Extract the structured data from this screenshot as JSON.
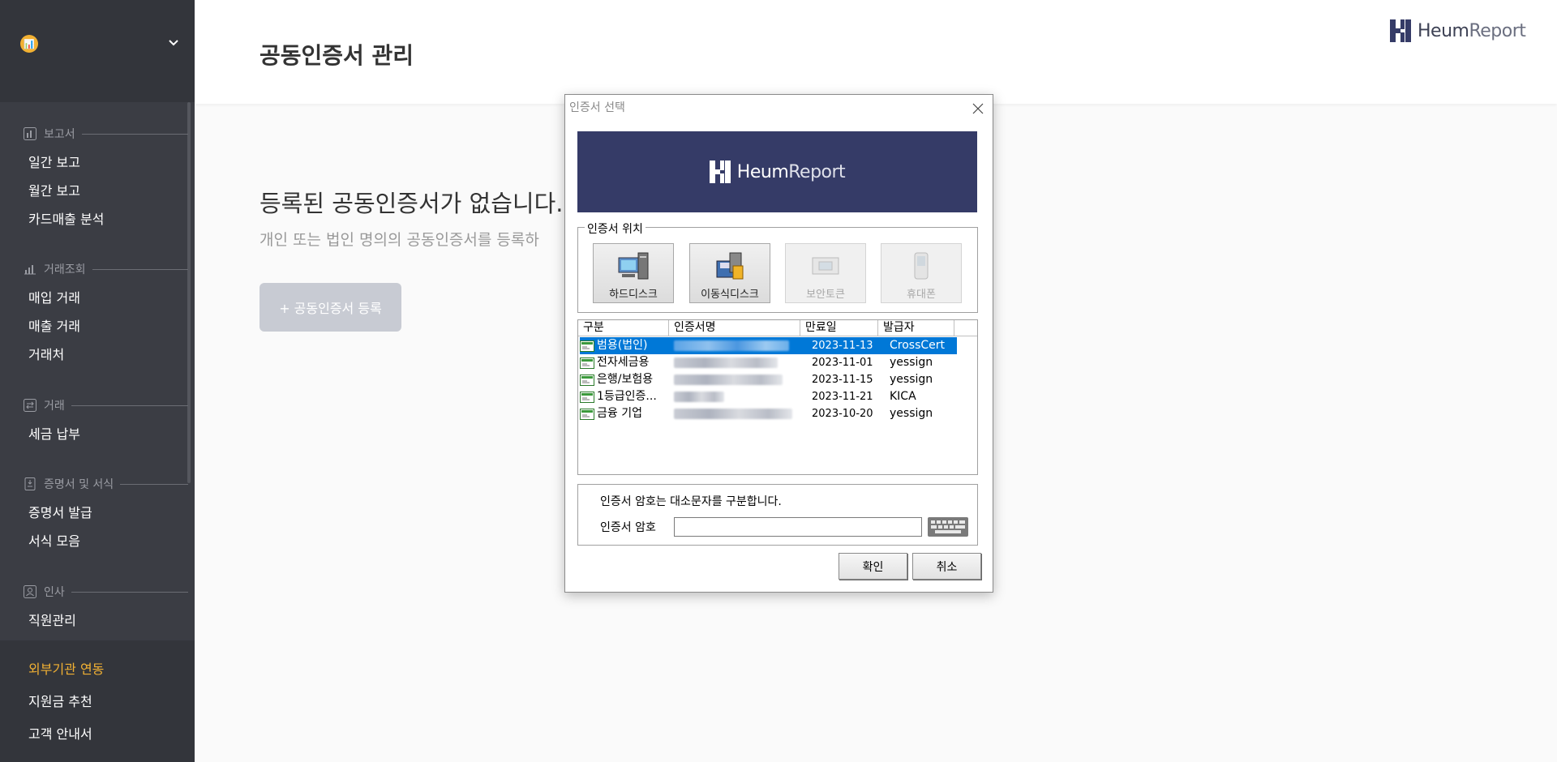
{
  "sidebar": {
    "org_icon_text": "📊",
    "sections": [
      {
        "title": "보고서",
        "icon": "report-icon",
        "items": [
          "일간 보고",
          "월간 보고",
          "카드매출 분석"
        ]
      },
      {
        "title": "거래조회",
        "icon": "chart-icon",
        "items": [
          "매입 거래",
          "매출 거래",
          "거래처"
        ]
      },
      {
        "title": "거래",
        "icon": "exchange-icon",
        "items": [
          "세금 납부"
        ]
      },
      {
        "title": "증명서 및 서식",
        "icon": "document-icon",
        "items": [
          "증명서 발급",
          "서식 모음"
        ]
      },
      {
        "title": "인사",
        "icon": "person-icon",
        "items": [
          "직원관리"
        ]
      }
    ],
    "bottom_items": [
      "외부기관 연동",
      "지원금 추천",
      "고객 안내서"
    ],
    "active_item": "외부기관 연동"
  },
  "header": {
    "page_title": "공동인증서 관리",
    "brand_bold": "Heum",
    "brand_light": "Report"
  },
  "empty_state": {
    "title": "등록된 공동인증서가 없습니다.",
    "subtitle": "개인 또는 법인 명의의 공동인증서를 등록하",
    "register_button": "+ 공동인증서 등록"
  },
  "dialog": {
    "title": "인증서 선택",
    "banner_brand_bold": "Heum",
    "banner_brand_light": "Report",
    "location_legend": "인증서 위치",
    "locations": [
      {
        "label": "하드디스크",
        "enabled": true
      },
      {
        "label": "이동식디스크",
        "enabled": true
      },
      {
        "label": "보안토큰",
        "enabled": false
      },
      {
        "label": "휴대폰",
        "enabled": false
      }
    ],
    "columns": [
      "구분",
      "인증서명",
      "만료일",
      "발급자"
    ],
    "certificates": [
      {
        "type": "범용(법인)",
        "expiry": "2023-11-13",
        "issuer": "CrossCert",
        "selected": true
      },
      {
        "type": "전자세금용",
        "expiry": "2023-11-01",
        "issuer": "yessign",
        "selected": false
      },
      {
        "type": "은행/보험용",
        "expiry": "2023-11-15",
        "issuer": "yessign",
        "selected": false
      },
      {
        "type": "1등급인증...",
        "expiry": "2023-11-21",
        "issuer": "KICA",
        "selected": false
      },
      {
        "type": "금융 기업",
        "expiry": "2023-10-20",
        "issuer": "yessign",
        "selected": false
      }
    ],
    "password_note": "인증서 암호는 대소문자를 구분합니다.",
    "password_label": "인증서 암호",
    "password_value": "",
    "confirm_button": "확인",
    "cancel_button": "취소",
    "colors": {
      "selection": "#0078d7",
      "banner": "#353b67"
    }
  },
  "colors": {
    "sidebar": "#3b3d44",
    "active": "#f2b133",
    "button_disabled": "#c8cbd3"
  }
}
